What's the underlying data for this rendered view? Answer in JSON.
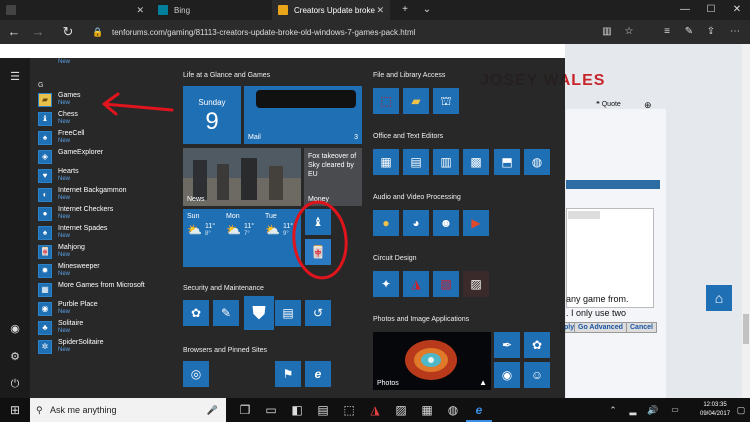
{
  "browser": {
    "tabs": [
      {
        "label": "",
        "active": false
      },
      {
        "label": "Bing",
        "active": false
      },
      {
        "label": "Creators Update broke",
        "active": true
      }
    ],
    "address": "tenforums.com/gaming/81113-creators-update-broke-old-windows-7-games-pack.html"
  },
  "webpage": {
    "banner": "JOSEY WALES",
    "quote_label": "Quote",
    "body_line1": "any game from.",
    "body_line2": ". I only use two",
    "buttons": [
      "ply",
      "Go Advanced",
      "Cancel"
    ]
  },
  "start_menu": {
    "top_item_new": "New",
    "section_letter": "G",
    "apps": [
      {
        "name": "Games",
        "badge": "New",
        "icon": "folder-icon"
      },
      {
        "name": "Chess",
        "badge": "New",
        "icon": "chess-icon"
      },
      {
        "name": "FreeCell",
        "badge": "New",
        "icon": "cards-icon"
      },
      {
        "name": "GameExplorer",
        "badge": "",
        "icon": "gamepad-icon"
      },
      {
        "name": "Hearts",
        "badge": "New",
        "icon": "hearts-icon"
      },
      {
        "name": "Internet Backgammon",
        "badge": "New",
        "icon": "backgammon-icon"
      },
      {
        "name": "Internet Checkers",
        "badge": "New",
        "icon": "checkers-icon"
      },
      {
        "name": "Internet Spades",
        "badge": "New",
        "icon": "spades-icon"
      },
      {
        "name": "Mahjong",
        "badge": "New",
        "icon": "mahjong-icon"
      },
      {
        "name": "Minesweeper",
        "badge": "New",
        "icon": "mine-icon"
      },
      {
        "name": "More Games from Microsoft",
        "badge": "",
        "icon": "games-icon"
      },
      {
        "name": "Purble Place",
        "badge": "New",
        "icon": "purble-icon"
      },
      {
        "name": "Solitaire",
        "badge": "New",
        "icon": "solitaire-icon"
      },
      {
        "name": "SpiderSolitaire",
        "badge": "New",
        "icon": "spider-icon"
      }
    ],
    "groups": {
      "life": "Life at a Glance and Games",
      "security": "Security and Maintenance",
      "browsers": "Browsers and Pinned Sites",
      "file": "File and Library Access",
      "office": "Office and Text Editors",
      "audio": "Audio and Video Processing",
      "circuit": "Circuit Design",
      "photos": "Photos and Image Applications"
    },
    "tiles": {
      "calendar_day": "Sunday",
      "calendar_date": "9",
      "mail_label": "Mail",
      "mail_count": "3",
      "news_label": "News",
      "money_headline": "Fox takeover of Sky cleared by EU",
      "money_label": "Money",
      "photos_label": "Photos",
      "weather": [
        {
          "day": "Sun",
          "high": "11°",
          "low": "8°"
        },
        {
          "day": "Mon",
          "high": "11°",
          "low": "7°"
        },
        {
          "day": "Tue",
          "high": "11°",
          "low": "9°"
        }
      ]
    }
  },
  "taskbar": {
    "search_placeholder": "Ask me anything",
    "time": "12:03:35",
    "date": "09/04/2017"
  },
  "colors": {
    "tile_blue": "#1f6fb5",
    "annotation_red": "#e0141c",
    "start_bg": "#1f1f1f"
  }
}
